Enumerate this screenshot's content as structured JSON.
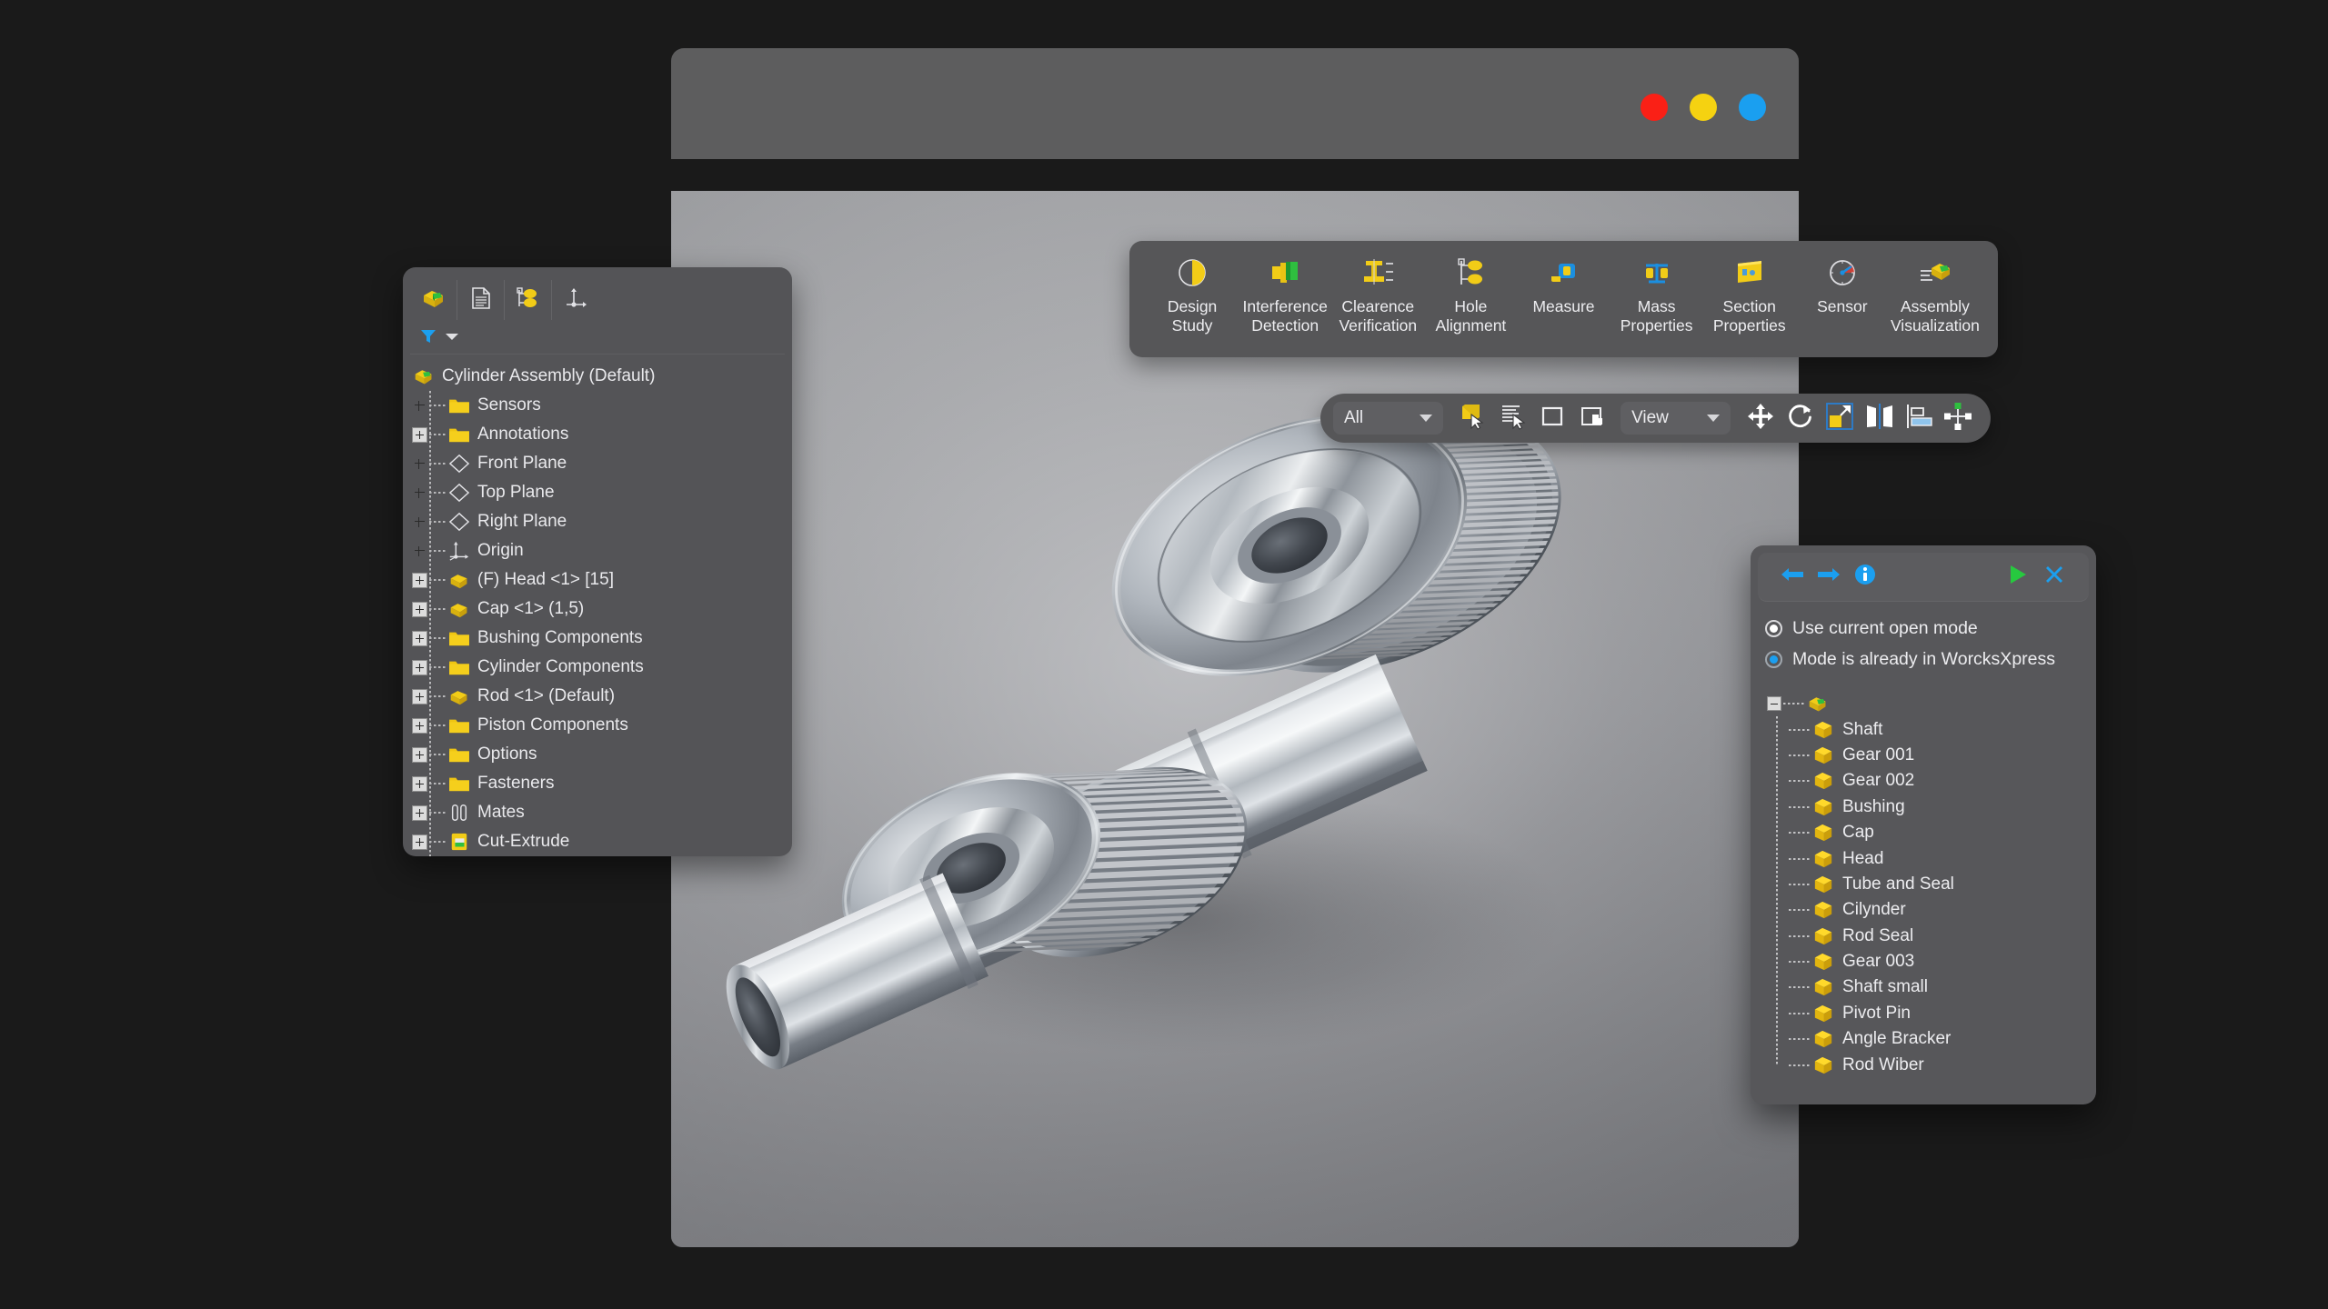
{
  "window": {
    "traffic_lights": [
      {
        "name": "close",
        "color": "#fa2016"
      },
      {
        "name": "minimize",
        "color": "#f5d211"
      },
      {
        "name": "maximize",
        "color": "#1a9ff0"
      }
    ]
  },
  "feature_tree": {
    "tabs": [
      {
        "icon": "assembly-tree-icon",
        "label": ""
      },
      {
        "icon": "property-manager-icon",
        "label": ""
      },
      {
        "icon": "configuration-manager-icon",
        "label": ""
      },
      {
        "icon": "display-manager-icon",
        "label": ""
      }
    ],
    "filter": {
      "icon": "filter-funnel-icon",
      "dropdown": "chevron-down-icon"
    },
    "root": {
      "label": "Cylinder Assembly (Default)",
      "icon": "assembly-icon"
    },
    "items": [
      {
        "label": "Sensors",
        "icon": "folder-icon",
        "expandable": false
      },
      {
        "label": "Annotations",
        "icon": "folder-icon",
        "expandable": true
      },
      {
        "label": "Front Plane",
        "icon": "plane-icon",
        "expandable": false
      },
      {
        "label": "Top Plane",
        "icon": "plane-icon",
        "expandable": false
      },
      {
        "label": "Right Plane",
        "icon": "plane-icon",
        "expandable": false
      },
      {
        "label": "Origin",
        "icon": "origin-icon",
        "expandable": false
      },
      {
        "label": "(F) Head <1> [15]",
        "icon": "part-icon",
        "expandable": true
      },
      {
        "label": "Cap <1> (1,5)",
        "icon": "part-icon",
        "expandable": true
      },
      {
        "label": "Bushing Components",
        "icon": "folder-icon",
        "expandable": true
      },
      {
        "label": "Cylinder Components",
        "icon": "folder-icon",
        "expandable": true
      },
      {
        "label": "Rod <1> (Default)",
        "icon": "part-icon",
        "expandable": true
      },
      {
        "label": "Piston Components",
        "icon": "folder-icon",
        "expandable": true
      },
      {
        "label": "Options",
        "icon": "folder-icon",
        "expandable": true
      },
      {
        "label": "Fasteners",
        "icon": "folder-icon",
        "expandable": true
      },
      {
        "label": "Mates",
        "icon": "mates-icon",
        "expandable": true
      },
      {
        "label": "Cut-Extrude",
        "icon": "cut-extrude-icon",
        "expandable": true
      }
    ]
  },
  "ribbon": {
    "items": [
      {
        "label": "Design\nStudy",
        "icon": "design-study-icon"
      },
      {
        "label": "Interference\nDetection",
        "icon": "interference-detection-icon"
      },
      {
        "label": "Clearence\nVerification",
        "icon": "clearance-verification-icon"
      },
      {
        "label": "Hole\nAlignment",
        "icon": "hole-alignment-icon"
      },
      {
        "label": "Measure",
        "icon": "measure-icon"
      },
      {
        "label": "Mass\nProperties",
        "icon": "mass-properties-icon"
      },
      {
        "label": "Section\nProperties",
        "icon": "section-properties-icon"
      },
      {
        "label": "Sensor",
        "icon": "sensor-icon"
      },
      {
        "label": "Assembly\nVisualization",
        "icon": "assembly-visualization-icon"
      }
    ]
  },
  "viewbar": {
    "scope_select": {
      "value": "All",
      "icon": "chevron-down-icon"
    },
    "view_select": {
      "value": "View",
      "icon": "chevron-down-icon"
    },
    "buttons": [
      {
        "name": "select-face-button",
        "icon": "select-face-icon"
      },
      {
        "name": "select-list-button",
        "icon": "select-list-icon"
      },
      {
        "name": "box-select-button",
        "icon": "box-select-icon"
      },
      {
        "name": "select-over-button",
        "icon": "select-overlap-icon"
      },
      {
        "name": "move-component-button",
        "icon": "move-arrows-icon"
      },
      {
        "name": "rotate-component-button",
        "icon": "rotate-icon"
      },
      {
        "name": "explode-view-button",
        "icon": "explode-icon"
      },
      {
        "name": "mirror-button",
        "icon": "mirror-icon"
      },
      {
        "name": "align-button",
        "icon": "align-icon"
      },
      {
        "name": "coordinate-system-button",
        "icon": "coordinate-system-icon"
      }
    ]
  },
  "dialog": {
    "header_buttons": [
      {
        "name": "back-button",
        "icon": "arrow-left-icon",
        "color": "#1b9ff0"
      },
      {
        "name": "forward-button",
        "icon": "arrow-right-icon",
        "color": "#1b9ff0"
      },
      {
        "name": "info-button",
        "icon": "info-icon",
        "color": "#1b9ff0"
      },
      {
        "name": "run-button",
        "icon": "play-icon",
        "color": "#27c93f"
      },
      {
        "name": "close-button",
        "icon": "close-x-icon",
        "color": "#1b9ff0"
      }
    ],
    "options": [
      {
        "label": "Use current open mode",
        "selected": true,
        "style": "white"
      },
      {
        "label": "Mode is already in WorcksXpress",
        "selected": true,
        "style": "blue"
      }
    ],
    "tree_root": {
      "icon": "assembly-icon",
      "expandable": true
    },
    "parts": [
      {
        "label": "Shaft",
        "icon": "part-cube-icon"
      },
      {
        "label": "Gear 001",
        "icon": "part-cube-icon"
      },
      {
        "label": "Gear 002",
        "icon": "part-cube-icon"
      },
      {
        "label": "Bushing",
        "icon": "part-cube-icon"
      },
      {
        "label": "Cap",
        "icon": "part-cube-icon"
      },
      {
        "label": "Head",
        "icon": "part-cube-icon"
      },
      {
        "label": "Tube and Seal",
        "icon": "part-cube-icon"
      },
      {
        "label": "Cilynder",
        "icon": "part-cube-icon"
      },
      {
        "label": "Rod Seal",
        "icon": "part-cube-icon"
      },
      {
        "label": "Gear 003",
        "icon": "part-cube-icon"
      },
      {
        "label": "Shaft small",
        "icon": "part-cube-icon"
      },
      {
        "label": "Pivot Pin",
        "icon": "part-cube-icon"
      },
      {
        "label": "Angle Bracker",
        "icon": "part-cube-icon"
      },
      {
        "label": "Rod Wiber",
        "icon": "part-cube-icon"
      }
    ]
  },
  "viewport": {
    "model_name": "gear-assembly-render"
  },
  "colors": {
    "accent_blue": "#1b9ff0",
    "accent_green": "#27c93f",
    "icon_yellow": "#f2cc17",
    "panel_bg": "#565658",
    "canvas_bg": "#a7a8ab"
  }
}
